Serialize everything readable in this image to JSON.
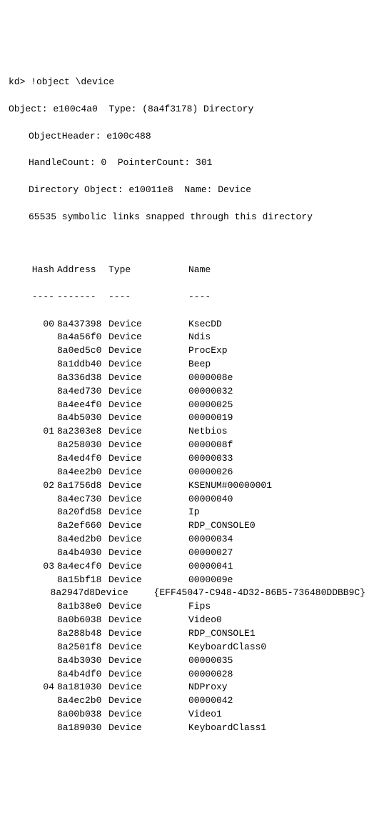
{
  "prompt": "kd> !object \\device",
  "header": {
    "line1": "Object: e100c4a0  Type: (8a4f3178) Directory",
    "line2": "ObjectHeader: e100c488",
    "line3": "HandleCount: 0  PointerCount: 301",
    "line4": "Directory Object: e10011e8  Name: Device",
    "line5": "65535 symbolic links snapped through this directory"
  },
  "columns": {
    "hash": "Hash",
    "address": "Address",
    "type": "Type",
    "name": "Name"
  },
  "dividers": {
    "hash": "----",
    "address": "-------",
    "type": "----",
    "name": "----"
  },
  "rows": [
    {
      "hash": "00",
      "address": "8a437398",
      "type": "Device",
      "name": "KsecDD"
    },
    {
      "hash": "",
      "address": "8a4a56f0",
      "type": "Device",
      "name": "Ndis"
    },
    {
      "hash": "",
      "address": "8a0ed5c0",
      "type": "Device",
      "name": "ProcExp"
    },
    {
      "hash": "",
      "address": "8a1ddb40",
      "type": "Device",
      "name": "Beep"
    },
    {
      "hash": "",
      "address": "8a336d38",
      "type": "Device",
      "name": "0000008e"
    },
    {
      "hash": "",
      "address": "8a4ed730",
      "type": "Device",
      "name": "00000032"
    },
    {
      "hash": "",
      "address": "8a4ee4f0",
      "type": "Device",
      "name": "00000025"
    },
    {
      "hash": "",
      "address": "8a4b5030",
      "type": "Device",
      "name": "00000019"
    },
    {
      "hash": "01",
      "address": "8a2303e8",
      "type": "Device",
      "name": "Netbios"
    },
    {
      "hash": "",
      "address": "8a258030",
      "type": "Device",
      "name": "0000008f"
    },
    {
      "hash": "",
      "address": "8a4ed4f0",
      "type": "Device",
      "name": "00000033"
    },
    {
      "hash": "",
      "address": "8a4ee2b0",
      "type": "Device",
      "name": "00000026"
    },
    {
      "hash": "02",
      "address": "8a1756d8",
      "type": "Device",
      "name": "KSENUM#00000001"
    },
    {
      "hash": "",
      "address": "8a4ec730",
      "type": "Device",
      "name": "00000040"
    },
    {
      "hash": "",
      "address": "8a20fd58",
      "type": "Device",
      "name": "Ip"
    },
    {
      "hash": "",
      "address": "8a2ef660",
      "type": "Device",
      "name": "RDP_CONSOLE0"
    },
    {
      "hash": "",
      "address": "8a4ed2b0",
      "type": "Device",
      "name": "00000034"
    },
    {
      "hash": "",
      "address": "8a4b4030",
      "type": "Device",
      "name": "00000027"
    },
    {
      "hash": "03",
      "address": "8a4ec4f0",
      "type": "Device",
      "name": "00000041"
    },
    {
      "hash": "",
      "address": "8a15bf18",
      "type": "Device",
      "name": "0000009e"
    },
    {
      "hash": "",
      "address": "8a2947d8",
      "type": "Device",
      "name": "{EFF45047-C948-4D32-86B5-736480DDBB9C}"
    },
    {
      "hash": "",
      "address": "8a1b38e0",
      "type": "Device",
      "name": "Fips"
    },
    {
      "hash": "",
      "address": "8a0b6038",
      "type": "Device",
      "name": "Video0"
    },
    {
      "hash": "",
      "address": "8a288b48",
      "type": "Device",
      "name": "RDP_CONSOLE1"
    },
    {
      "hash": "",
      "address": "8a2501f8",
      "type": "Device",
      "name": "KeyboardClass0"
    },
    {
      "hash": "",
      "address": "8a4b3030",
      "type": "Device",
      "name": "00000035"
    },
    {
      "hash": "",
      "address": "8a4b4df0",
      "type": "Device",
      "name": "00000028"
    },
    {
      "hash": "04",
      "address": "8a181030",
      "type": "Device",
      "name": "NDProxy"
    },
    {
      "hash": "",
      "address": "8a4ec2b0",
      "type": "Device",
      "name": "00000042"
    },
    {
      "hash": "",
      "address": "8a00b038",
      "type": "Device",
      "name": "Video1"
    },
    {
      "hash": "",
      "address": "8a189030",
      "type": "Device",
      "name": "KeyboardClass1"
    }
  ]
}
